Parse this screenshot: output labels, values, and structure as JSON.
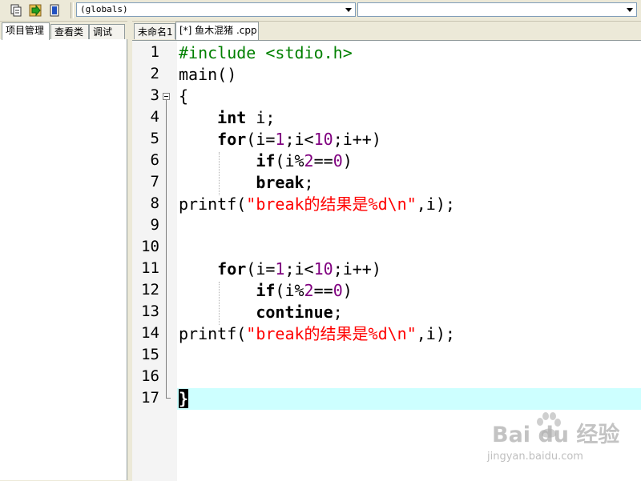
{
  "toolbar": {
    "icons": [
      "compile-icon",
      "run-icon",
      "debug-icon"
    ],
    "scope_combo": "(globals)",
    "member_combo": ""
  },
  "left_panel": {
    "tabs": [
      {
        "label": "项目管理",
        "active": true
      },
      {
        "label": "查看类",
        "active": false
      },
      {
        "label": "调试",
        "active": false
      }
    ]
  },
  "editor": {
    "tabs": [
      {
        "label": "未命名1",
        "active": false
      },
      {
        "label": "[*] 鱼木混猪 .cpp",
        "active": true
      }
    ],
    "line_numbers": [
      "1",
      "2",
      "3",
      "4",
      "5",
      "6",
      "7",
      "8",
      "9",
      "10",
      "11",
      "12",
      "13",
      "14",
      "15",
      "16",
      "17"
    ],
    "code": {
      "l1_directive": "#include <stdio.h>",
      "l2_text": "main()",
      "l3_text": "{",
      "l4_kw": "int",
      "l4_rest": " i;",
      "for_kw": "for",
      "for_open": "(i=",
      "for_n1": "1",
      "for_mid": ";i<",
      "for_n2": "10",
      "for_close": ";i++)",
      "if_kw": "if",
      "if_open": "(i%",
      "if_n1": "2",
      "if_eq": "==",
      "if_n2": "0",
      "if_close": ")",
      "l7_kw": "break",
      "l7_rest": ";",
      "l13_kw": "continue",
      "l13_rest": ";",
      "printf_fn": "printf(",
      "printf_str": "\"break的结果是%d\\n\"",
      "printf_rest": ",i);",
      "l17_brace": "}"
    },
    "current_line": 17
  },
  "watermark": {
    "logo": "Bai du 经验",
    "url": "jingyan.baidu.com"
  },
  "colors": {
    "keyword": "#000000",
    "preprocessor": "#008000",
    "number": "#800080",
    "string": "#ff0000",
    "current_line_bg": "#cdffff"
  }
}
